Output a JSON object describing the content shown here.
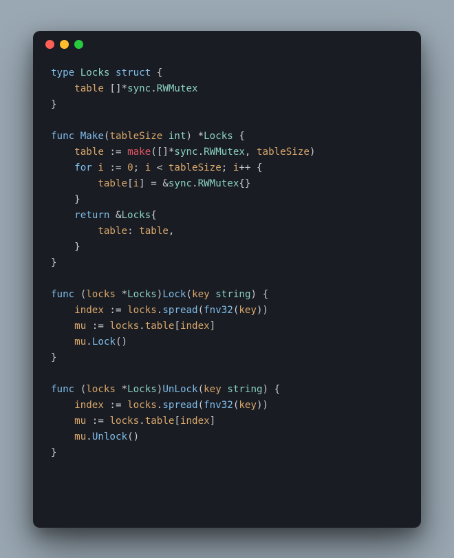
{
  "window": {
    "traffic_lights": [
      "red",
      "yellow",
      "green"
    ]
  },
  "code": {
    "language": "go",
    "tokens": [
      [
        [
          "kw",
          "type"
        ],
        [
          "",
          " "
        ],
        [
          "typ",
          "Locks"
        ],
        [
          "",
          " "
        ],
        [
          "kw",
          "struct"
        ],
        [
          "",
          " {"
        ]
      ],
      [
        [
          "",
          "    "
        ],
        [
          "fld",
          "table"
        ],
        [
          "",
          " []*"
        ],
        [
          "pkg",
          "sync"
        ],
        [
          "",
          "."
        ],
        [
          "typ",
          "RWMutex"
        ]
      ],
      [
        [
          "",
          "}"
        ]
      ],
      [
        [
          "",
          ""
        ]
      ],
      [
        [
          "kw",
          "func"
        ],
        [
          "",
          " "
        ],
        [
          "fn",
          "Make"
        ],
        [
          "",
          "("
        ],
        [
          "fld",
          "tableSize"
        ],
        [
          "",
          " "
        ],
        [
          "typ",
          "int"
        ],
        [
          "",
          ") *"
        ],
        [
          "typ",
          "Locks"
        ],
        [
          "",
          " {"
        ]
      ],
      [
        [
          "",
          "    "
        ],
        [
          "fld",
          "table"
        ],
        [
          "",
          " := "
        ],
        [
          "bltn",
          "make"
        ],
        [
          "",
          "([]*"
        ],
        [
          "pkg",
          "sync"
        ],
        [
          "",
          "."
        ],
        [
          "typ",
          "RWMutex"
        ],
        [
          "",
          ", "
        ],
        [
          "fld",
          "tableSize"
        ],
        [
          "",
          ")"
        ]
      ],
      [
        [
          "",
          "    "
        ],
        [
          "kw",
          "for"
        ],
        [
          "",
          " "
        ],
        [
          "fld",
          "i"
        ],
        [
          "",
          " := "
        ],
        [
          "num",
          "0"
        ],
        [
          "",
          "; "
        ],
        [
          "fld",
          "i"
        ],
        [
          "",
          " < "
        ],
        [
          "fld",
          "tableSize"
        ],
        [
          "",
          "; "
        ],
        [
          "fld",
          "i"
        ],
        [
          "",
          "++ {"
        ]
      ],
      [
        [
          "",
          "        "
        ],
        [
          "fld",
          "table"
        ],
        [
          "",
          "["
        ],
        [
          "fld",
          "i"
        ],
        [
          "",
          "] = &"
        ],
        [
          "pkg",
          "sync"
        ],
        [
          "",
          "."
        ],
        [
          "typ",
          "RWMutex"
        ],
        [
          "",
          "{}"
        ]
      ],
      [
        [
          "",
          "    }"
        ]
      ],
      [
        [
          "",
          "    "
        ],
        [
          "kw",
          "return"
        ],
        [
          "",
          " &"
        ],
        [
          "typ",
          "Locks"
        ],
        [
          "",
          "{"
        ]
      ],
      [
        [
          "",
          "        "
        ],
        [
          "fld",
          "table"
        ],
        [
          "",
          ": "
        ],
        [
          "fld",
          "table"
        ],
        [
          "",
          ","
        ]
      ],
      [
        [
          "",
          "    }"
        ]
      ],
      [
        [
          "",
          "}"
        ]
      ],
      [
        [
          "",
          ""
        ]
      ],
      [
        [
          "kw",
          "func"
        ],
        [
          "",
          " ("
        ],
        [
          "fld",
          "locks"
        ],
        [
          "",
          " *"
        ],
        [
          "typ",
          "Locks"
        ],
        [
          "",
          ")"
        ],
        [
          "fn",
          "Lock"
        ],
        [
          "",
          "("
        ],
        [
          "fld",
          "key"
        ],
        [
          "",
          " "
        ],
        [
          "typ",
          "string"
        ],
        [
          "",
          ") {"
        ]
      ],
      [
        [
          "",
          "    "
        ],
        [
          "fld",
          "index"
        ],
        [
          "",
          " := "
        ],
        [
          "fld",
          "locks"
        ],
        [
          "",
          "."
        ],
        [
          "fn",
          "spread"
        ],
        [
          "",
          "("
        ],
        [
          "fn",
          "fnv32"
        ],
        [
          "",
          "("
        ],
        [
          "fld",
          "key"
        ],
        [
          "",
          "))"
        ]
      ],
      [
        [
          "",
          "    "
        ],
        [
          "fld",
          "mu"
        ],
        [
          "",
          " := "
        ],
        [
          "fld",
          "locks"
        ],
        [
          "",
          "."
        ],
        [
          "fld",
          "table"
        ],
        [
          "",
          "["
        ],
        [
          "fld",
          "index"
        ],
        [
          "",
          "]"
        ]
      ],
      [
        [
          "",
          "    "
        ],
        [
          "fld",
          "mu"
        ],
        [
          "",
          "."
        ],
        [
          "fn",
          "Lock"
        ],
        [
          "",
          "()"
        ]
      ],
      [
        [
          "",
          "}"
        ]
      ],
      [
        [
          "",
          ""
        ]
      ],
      [
        [
          "kw",
          "func"
        ],
        [
          "",
          " ("
        ],
        [
          "fld",
          "locks"
        ],
        [
          "",
          " *"
        ],
        [
          "typ",
          "Locks"
        ],
        [
          "",
          ")"
        ],
        [
          "fn",
          "UnLock"
        ],
        [
          "",
          "("
        ],
        [
          "fld",
          "key"
        ],
        [
          "",
          " "
        ],
        [
          "typ",
          "string"
        ],
        [
          "",
          ") {"
        ]
      ],
      [
        [
          "",
          "    "
        ],
        [
          "fld",
          "index"
        ],
        [
          "",
          " := "
        ],
        [
          "fld",
          "locks"
        ],
        [
          "",
          "."
        ],
        [
          "fn",
          "spread"
        ],
        [
          "",
          "("
        ],
        [
          "fn",
          "fnv32"
        ],
        [
          "",
          "("
        ],
        [
          "fld",
          "key"
        ],
        [
          "",
          "))"
        ]
      ],
      [
        [
          "",
          "    "
        ],
        [
          "fld",
          "mu"
        ],
        [
          "",
          " := "
        ],
        [
          "fld",
          "locks"
        ],
        [
          "",
          "."
        ],
        [
          "fld",
          "table"
        ],
        [
          "",
          "["
        ],
        [
          "fld",
          "index"
        ],
        [
          "",
          "]"
        ]
      ],
      [
        [
          "",
          "    "
        ],
        [
          "fld",
          "mu"
        ],
        [
          "",
          "."
        ],
        [
          "fn",
          "Unlock"
        ],
        [
          "",
          "()"
        ]
      ],
      [
        [
          "",
          "}"
        ]
      ]
    ]
  }
}
